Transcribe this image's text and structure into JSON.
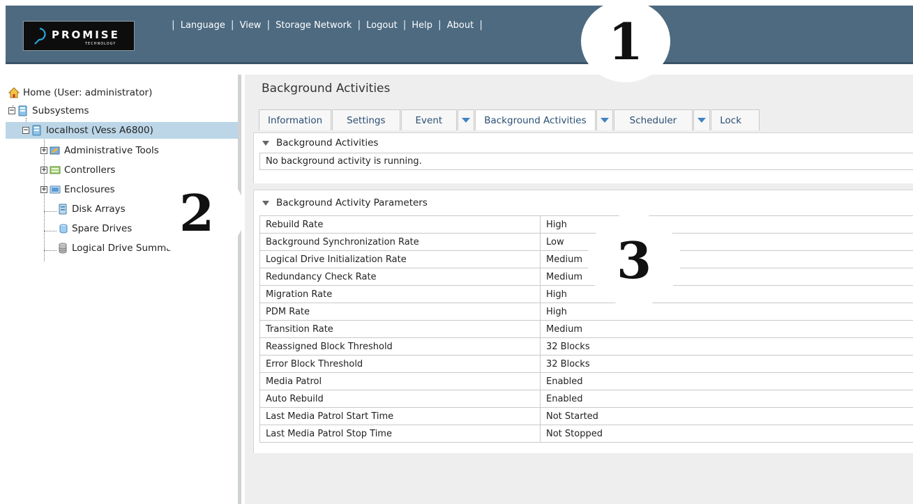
{
  "header": {
    "logo_name": "PROMISE",
    "logo_sub": "TECHNOLOGY",
    "nav": [
      "Language",
      "View",
      "Storage Network",
      "Logout",
      "Help",
      "About"
    ]
  },
  "tree": {
    "home": "Home (User: administrator)",
    "subsystems": "Subsystems",
    "host": "localhost (Vess A6800)",
    "admin_tools": "Administrative Tools",
    "controllers": "Controllers",
    "enclosures": "Enclosures",
    "disk_arrays": "Disk Arrays",
    "spare_drives": "Spare Drives",
    "logical_drive_summary": "Logical Drive Summary"
  },
  "main": {
    "title": "Background Activities",
    "tabs": {
      "information": "Information",
      "settings": "Settings",
      "event": "Event",
      "background": "Background Activities",
      "scheduler": "Scheduler",
      "lock": "Lock"
    },
    "activities_section": {
      "title": "Background Activities",
      "message": "No background activity is running."
    },
    "params_section": {
      "title": "Background Activity Parameters",
      "rows": [
        {
          "name": "Rebuild Rate",
          "value": "High"
        },
        {
          "name": "Background Synchronization Rate",
          "value": "Low"
        },
        {
          "name": "Logical Drive Initialization Rate",
          "value": "Medium"
        },
        {
          "name": "Redundancy Check Rate",
          "value": "Medium"
        },
        {
          "name": "Migration Rate",
          "value": "High"
        },
        {
          "name": "PDM Rate",
          "value": "High"
        },
        {
          "name": "Transition Rate",
          "value": "Medium"
        },
        {
          "name": "Reassigned Block Threshold",
          "value": "32 Blocks"
        },
        {
          "name": "Error Block Threshold",
          "value": "32 Blocks"
        },
        {
          "name": "Media Patrol",
          "value": "Enabled"
        },
        {
          "name": "Auto Rebuild",
          "value": "Enabled"
        },
        {
          "name": "Last Media Patrol Start Time",
          "value": "Not Started"
        },
        {
          "name": "Last Media Patrol Stop Time",
          "value": "Not Stopped"
        }
      ]
    }
  },
  "callouts": {
    "one": "1",
    "two": "2",
    "three": "3"
  }
}
